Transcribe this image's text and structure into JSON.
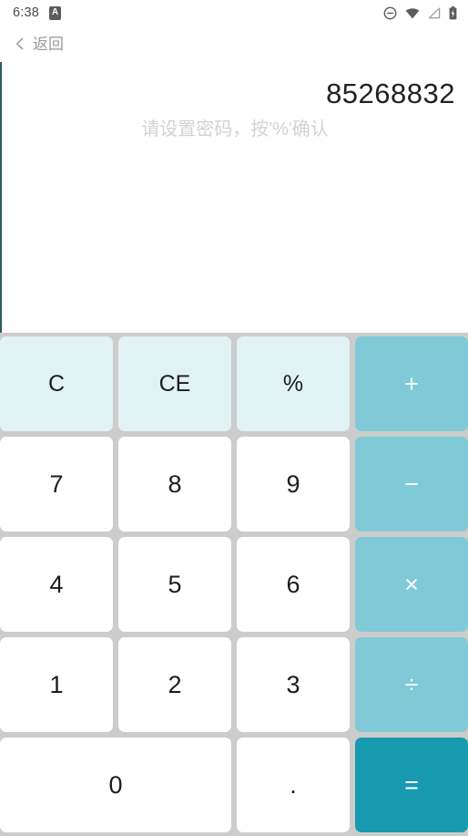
{
  "status_bar": {
    "time": "6:38",
    "notification_badge": "A",
    "icons": [
      "do-not-disturb-icon",
      "wifi-icon",
      "signal-icon",
      "battery-charging-icon"
    ]
  },
  "nav": {
    "back_label": "返回",
    "back_icon": "chevron-left-icon"
  },
  "display": {
    "value": "85268832",
    "hint": "请设置密码，按'%'确认"
  },
  "keypad": {
    "keys": [
      {
        "label": "C",
        "name": "key-clear",
        "style": "fn"
      },
      {
        "label": "CE",
        "name": "key-clear-entry",
        "style": "fn"
      },
      {
        "label": "%",
        "name": "key-percent",
        "style": "fn"
      },
      {
        "label": "+",
        "name": "key-plus",
        "style": "op"
      },
      {
        "label": "7",
        "name": "key-7",
        "style": "num"
      },
      {
        "label": "8",
        "name": "key-8",
        "style": "num"
      },
      {
        "label": "9",
        "name": "key-9",
        "style": "num"
      },
      {
        "label": "−",
        "name": "key-minus",
        "style": "op"
      },
      {
        "label": "4",
        "name": "key-4",
        "style": "num"
      },
      {
        "label": "5",
        "name": "key-5",
        "style": "num"
      },
      {
        "label": "6",
        "name": "key-6",
        "style": "num"
      },
      {
        "label": "×",
        "name": "key-multiply",
        "style": "op"
      },
      {
        "label": "1",
        "name": "key-1",
        "style": "num"
      },
      {
        "label": "2",
        "name": "key-2",
        "style": "num"
      },
      {
        "label": "3",
        "name": "key-3",
        "style": "num"
      },
      {
        "label": "÷",
        "name": "key-divide",
        "style": "op"
      },
      {
        "label": "0",
        "name": "key-0",
        "style": "num wide"
      },
      {
        "label": ".",
        "name": "key-decimal",
        "style": "num dot"
      },
      {
        "label": "=",
        "name": "key-equals",
        "style": "eq"
      }
    ]
  },
  "colors": {
    "function_key_bg": "#e1f2f4",
    "operator_key_bg": "#7fcad6",
    "equals_key_bg": "#179aaf",
    "number_key_bg": "#ffffff",
    "keypad_bg": "#cccccc",
    "accent_border": "#2d5d5f",
    "hint_text": "#d2d2d2",
    "back_text": "#9a9a9a"
  }
}
